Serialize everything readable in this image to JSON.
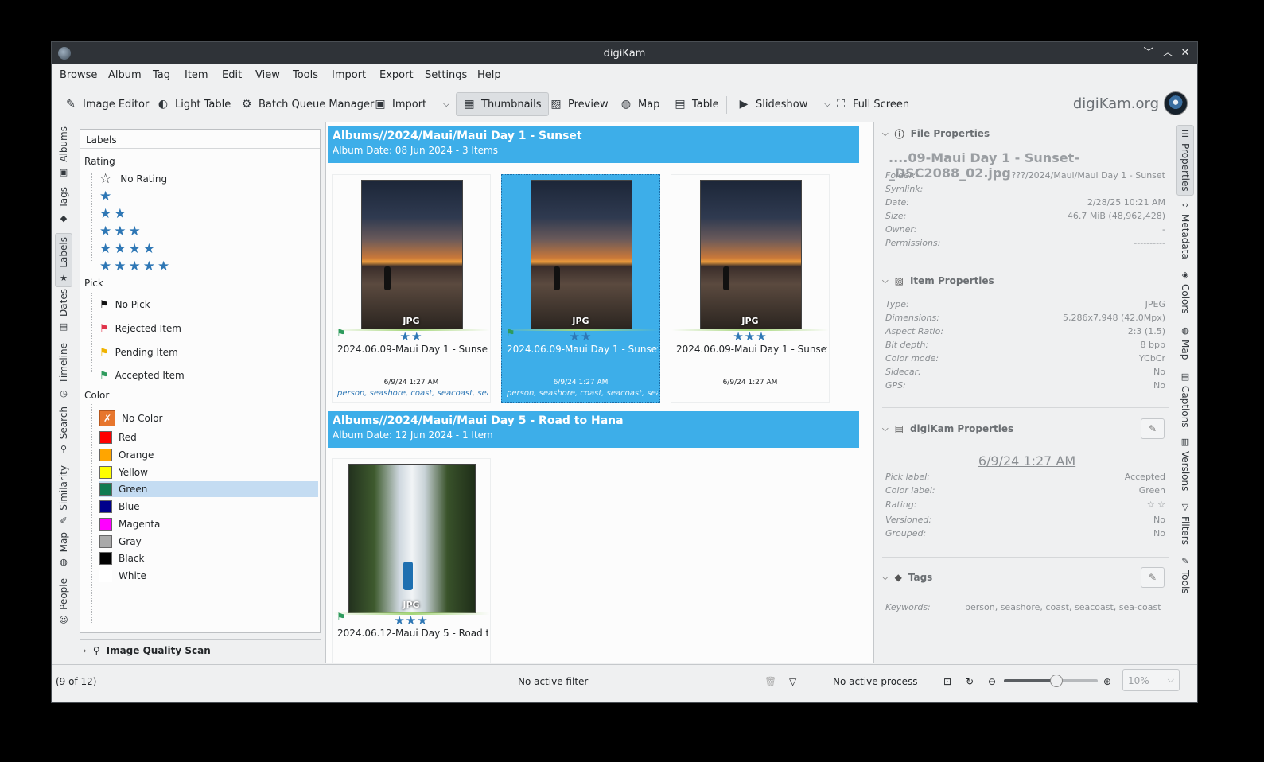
{
  "window": {
    "title": "digiKam"
  },
  "menu": [
    "Browse",
    "Album",
    "Tag",
    "Item",
    "Edit",
    "View",
    "Tools",
    "Import",
    "Export",
    "Settings",
    "Help"
  ],
  "toolbar": {
    "image_editor": "Image Editor",
    "light_table": "Light Table",
    "batch_queue": "Batch Queue Manager",
    "import": "Import",
    "thumbnails": "Thumbnails",
    "preview": "Preview",
    "map": "Map",
    "table": "Table",
    "slideshow": "Slideshow",
    "full_screen": "Full Screen",
    "brand": "digiKam.org"
  },
  "left_tabs": [
    "Albums",
    "Tags",
    "Labels",
    "Dates",
    "Timeline",
    "Search",
    "Similarity",
    "Map",
    "People"
  ],
  "labels_panel": {
    "header": "Labels",
    "rating_title": "Rating",
    "no_rating": "No Rating",
    "ratings": [
      1,
      2,
      3,
      4,
      5
    ],
    "pick_title": "Pick",
    "picks": [
      {
        "label": "No Pick",
        "color": "#111111"
      },
      {
        "label": "Rejected Item",
        "color": "#e0334a"
      },
      {
        "label": "Pending Item",
        "color": "#f0b300"
      },
      {
        "label": "Accepted Item",
        "color": "#2e9b5d"
      }
    ],
    "color_title": "Color",
    "no_color": "No Color",
    "colors": [
      {
        "label": "Red",
        "hex": "#ff0000"
      },
      {
        "label": "Orange",
        "hex": "#ffa500"
      },
      {
        "label": "Yellow",
        "hex": "#ffff00"
      },
      {
        "label": "Green",
        "hex": "#107b51"
      },
      {
        "label": "Blue",
        "hex": "#00008b"
      },
      {
        "label": "Magenta",
        "hex": "#ff00ff"
      },
      {
        "label": "Gray",
        "hex": "#a9a9a9"
      },
      {
        "label": "Black",
        "hex": "#000000"
      },
      {
        "label": "White",
        "hex": "#ffffff"
      }
    ],
    "selected_color": "Green",
    "image_quality_scan": "Image Quality Scan"
  },
  "albums": [
    {
      "path": "Albums//2024/Maui/Maui Day 1 - Sunset",
      "info": "Album Date: 08 Jun 2024 - 3 Items",
      "items": [
        {
          "format": "JPG",
          "stars": "★★",
          "name": "2024.06.09-Maui Day 1 - Sunset-...",
          "date": "6/9/24 1:27 AM",
          "tags": "person, seashore, coast, seacoast, sea...",
          "kind": "sunset"
        },
        {
          "format": "JPG",
          "stars": "★★",
          "name": "2024.06.09-Maui Day 1 - Sunset-...",
          "date": "6/9/24 1:27 AM",
          "tags": "person, seashore, coast, seacoast, sea...",
          "kind": "sunset"
        },
        {
          "format": "JPG",
          "stars": "★★★",
          "name": "2024.06.09-Maui Day 1 - Sunset-...",
          "date": "6/9/24 1:27 AM",
          "tags": "",
          "kind": "sunset"
        }
      ]
    },
    {
      "path": "Albums//2024/Maui/Maui Day 5 - Road to Hana",
      "info": "Album Date: 12 Jun 2024 - 1 Item",
      "items": [
        {
          "format": "JPG",
          "stars": "★★★",
          "name": "2024.06.12-Maui Day 5 - Road to...",
          "date": "",
          "tags": "",
          "kind": "falls"
        }
      ]
    }
  ],
  "properties": {
    "file_title": "File Properties",
    "file_name": "....09-Maui Day 1 - Sunset-_DSC2088_02.jpg",
    "file": [
      {
        "k": "Folder:",
        "v": "???/2024/Maui/Maui Day 1 - Sunset"
      },
      {
        "k": "Symlink:",
        "v": ""
      },
      {
        "k": "Date:",
        "v": "2/28/25 10:21 AM"
      },
      {
        "k": "Size:",
        "v": "46.7 MiB (48,962,428)"
      },
      {
        "k": "Owner:",
        "v": "-"
      },
      {
        "k": "Permissions:",
        "v": "----------"
      }
    ],
    "item_title": "Item Properties",
    "item": [
      {
        "k": "Type:",
        "v": "JPEG"
      },
      {
        "k": "Dimensions:",
        "v": "5,286x7,948 (42.0Mpx)"
      },
      {
        "k": "Aspect Ratio:",
        "v": "2:3 (1.5)"
      },
      {
        "k": "Bit depth:",
        "v": "8 bpp"
      },
      {
        "k": "Color mode:",
        "v": "YCbCr"
      },
      {
        "k": "Sidecar:",
        "v": "No"
      },
      {
        "k": "GPS:",
        "v": "No"
      }
    ],
    "digikam_title": "digiKam Properties",
    "digikam_date": "6/9/24 1:27 AM",
    "digikam": [
      {
        "k": "Pick label:",
        "v": "Accepted"
      },
      {
        "k": "Color label:",
        "v": "Green"
      },
      {
        "k": "Rating:",
        "v": "☆ ☆"
      },
      {
        "k": "Versioned:",
        "v": "No"
      },
      {
        "k": "Grouped:",
        "v": "No"
      }
    ],
    "tags_title": "Tags",
    "keywords_label": "Keywords:",
    "keywords": "person, seashore, coast, seacoast, sea-coast"
  },
  "right_tabs": [
    "Properties",
    "Metadata",
    "Colors",
    "Map",
    "Captions",
    "Versions",
    "Filters",
    "Tools"
  ],
  "status": {
    "count": "(9 of 12)",
    "filter": "No active filter",
    "process": "No active process",
    "zoom": "10%",
    "zoom_level": 0.56
  }
}
